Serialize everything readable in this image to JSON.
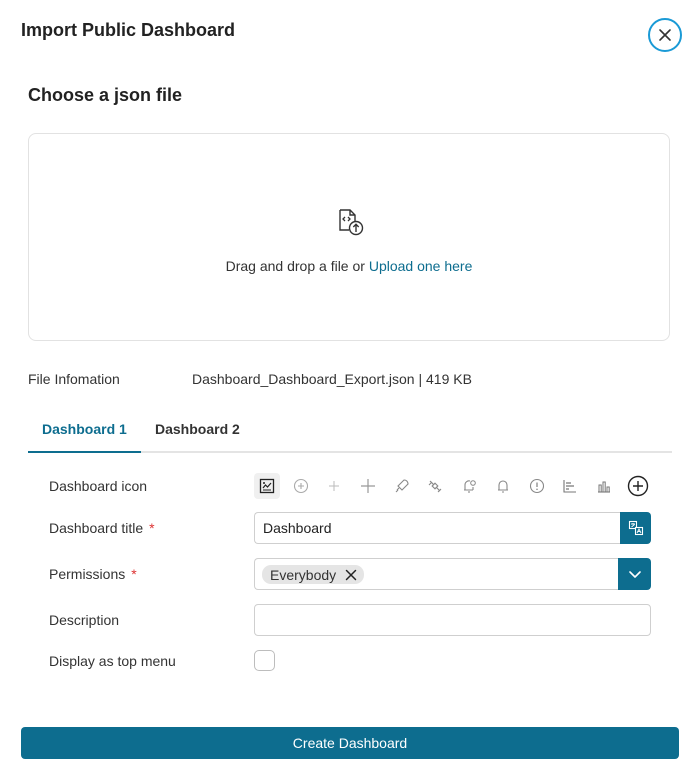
{
  "dialog": {
    "title": "Import Public Dashboard",
    "close_icon": "close-icon"
  },
  "upload": {
    "section_title": "Choose a json file",
    "icon": "file-code-upload-icon",
    "drag_text": "Drag and drop a file or ",
    "link_text": "Upload one here"
  },
  "file_info": {
    "label": "File Infomation",
    "value": "Dashboard_Dashboard_Export.json | 419 KB"
  },
  "tabs": [
    {
      "label": "Dashboard 1",
      "active": true
    },
    {
      "label": "Dashboard 2",
      "active": false
    }
  ],
  "form": {
    "icon_label": "Dashboard icon",
    "icons": [
      "dashboard-chart-icon",
      "plus-circle-icon",
      "plus-small-icon",
      "plus-icon",
      "rocket-icon",
      "satellite-icon",
      "bell-gear-icon",
      "bell-icon",
      "alert-circle-icon",
      "bar-chart-horizontal-icon",
      "bar-chart-icon",
      "add-circle-icon"
    ],
    "title_label": "Dashboard title",
    "title_required": "*",
    "title_value": "Dashboard",
    "permissions_label": "Permissions",
    "permissions_required": "*",
    "permissions_chips": [
      "Everybody"
    ],
    "description_label": "Description",
    "description_value": "",
    "top_menu_label": "Display as top menu",
    "top_menu_checked": false
  },
  "footer": {
    "create_label": "Create Dashboard"
  },
  "colors": {
    "accent": "#0d6d8f",
    "close_ring": "#1a9ad6",
    "required": "#dd3333"
  }
}
